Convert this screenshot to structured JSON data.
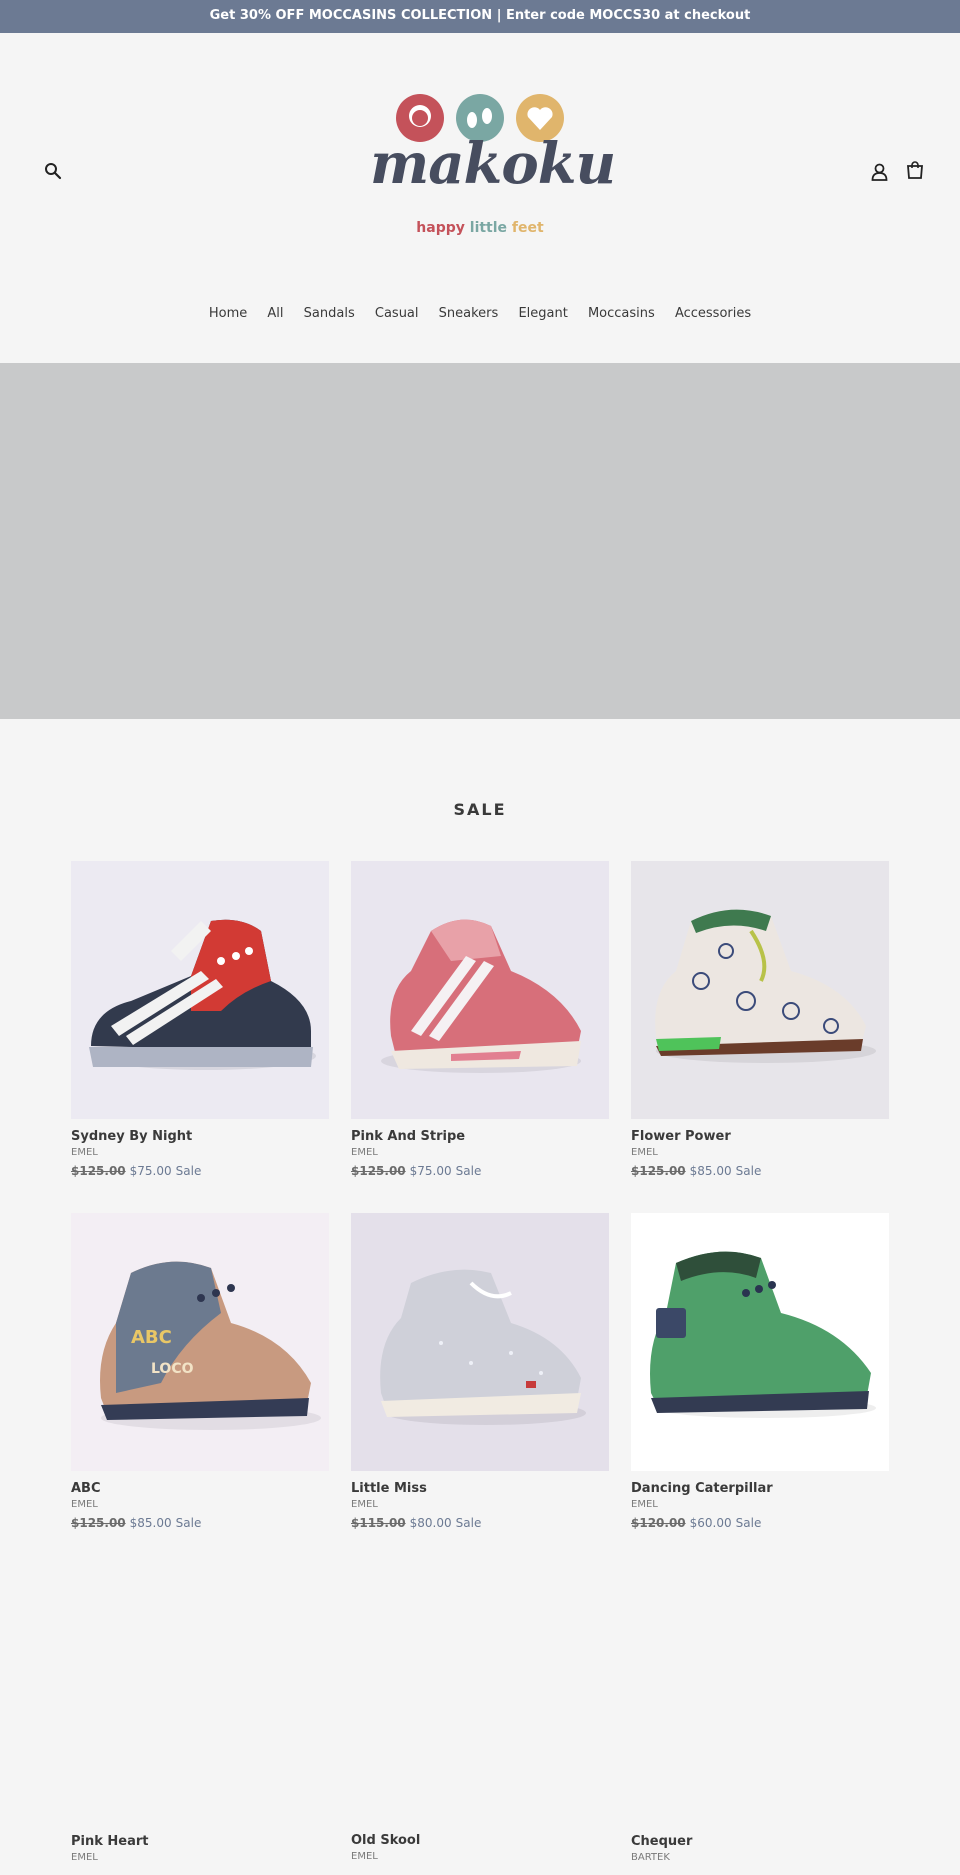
{
  "announcement": "Get 30% OFF MOCCASINS COLLECTION | Enter code MOCCS30 at checkout",
  "header": {
    "logo_word": "makoku",
    "logo_tagline": [
      "happy",
      "little",
      "feet"
    ],
    "icons": {
      "search": "search-icon",
      "account": "account-icon",
      "cart": "cart-icon"
    }
  },
  "nav": [
    "Home",
    "All",
    "Sandals",
    "Casual",
    "Sneakers",
    "Elegant",
    "Moccasins",
    "Accessories"
  ],
  "section_title": "SALE",
  "products": [
    {
      "title": "Sydney By Night",
      "vendor": "EMEL",
      "price_old": "$125.00",
      "price_new": "$75.00",
      "sale_label": "Sale"
    },
    {
      "title": "Pink And Stripe",
      "vendor": "EMEL",
      "price_old": "$125.00",
      "price_new": "$75.00",
      "sale_label": "Sale"
    },
    {
      "title": "Flower Power",
      "vendor": "EMEL",
      "price_old": "$125.00",
      "price_new": "$85.00",
      "sale_label": "Sale"
    },
    {
      "title": "ABC",
      "vendor": "EMEL",
      "price_old": "$125.00",
      "price_new": "$85.00",
      "sale_label": "Sale"
    },
    {
      "title": "Little Miss",
      "vendor": "EMEL",
      "price_old": "$115.00",
      "price_new": "$80.00",
      "sale_label": "Sale"
    },
    {
      "title": "Dancing Caterpillar",
      "vendor": "EMEL",
      "price_old": "$120.00",
      "price_new": "$60.00",
      "sale_label": "Sale"
    },
    {
      "title": "Pink Heart",
      "vendor": "EMEL"
    },
    {
      "title": "Old Skool",
      "vendor": "EMEL"
    },
    {
      "title": "Chequer",
      "vendor": "BARTEK"
    }
  ],
  "colors": {
    "accent": "#6c7a93",
    "background": "#f5f5f5",
    "hero_placeholder": "#c8c9ca"
  }
}
